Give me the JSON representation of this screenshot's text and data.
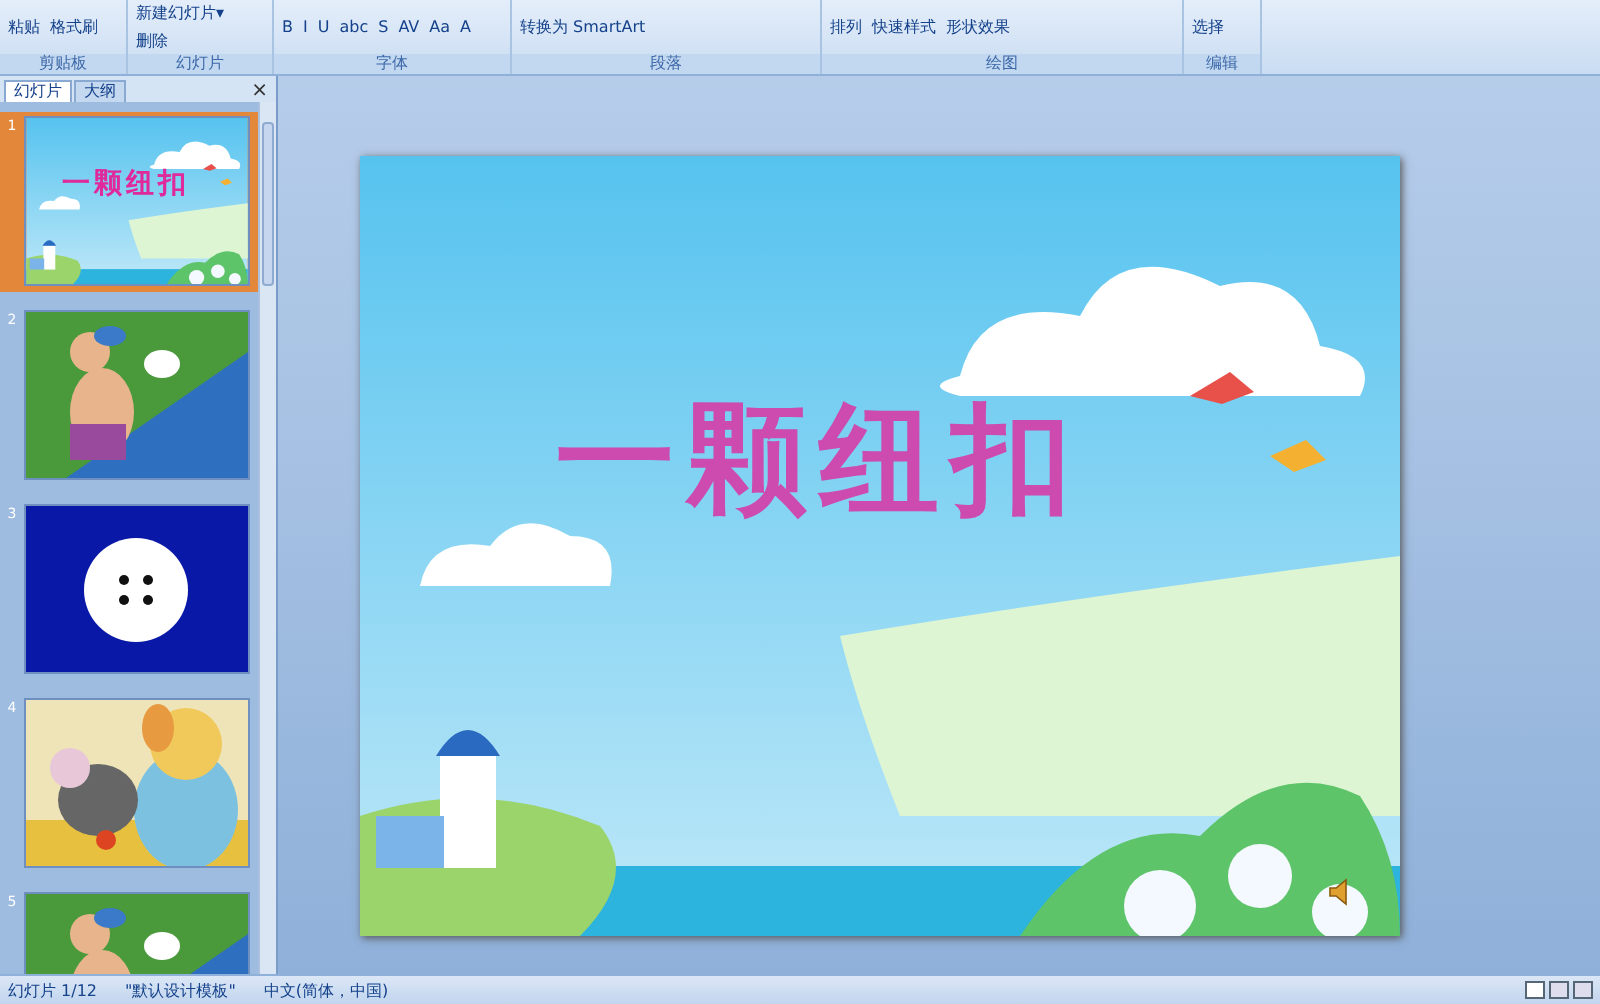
{
  "ribbon": {
    "groups": [
      {
        "label": "剪贴板",
        "buttons": [
          "粘贴",
          "格式刷"
        ]
      },
      {
        "label": "幻灯片",
        "buttons": [
          "新建幻灯片▾",
          "删除"
        ]
      },
      {
        "label": "字体",
        "buttons": [
          "B",
          "I",
          "U",
          "abc",
          "S",
          "AV",
          "Aa",
          "A"
        ]
      },
      {
        "label": "段落",
        "buttons": [
          "转换为 SmartArt"
        ]
      },
      {
        "label": "绘图",
        "buttons": [
          "排列",
          "快速样式",
          "形状效果"
        ]
      },
      {
        "label": "编辑",
        "buttons": [
          "选择"
        ]
      }
    ]
  },
  "panel": {
    "tabs": [
      {
        "label": "幻灯片",
        "selected": true
      },
      {
        "label": "大纲",
        "selected": false
      }
    ],
    "close": "×",
    "slides": [
      {
        "number": "1",
        "selected": true,
        "kind": "title",
        "title": "一颗纽扣"
      },
      {
        "number": "2",
        "selected": false,
        "kind": "picture"
      },
      {
        "number": "3",
        "selected": false,
        "kind": "button"
      },
      {
        "number": "4",
        "selected": false,
        "kind": "picture"
      },
      {
        "number": "5",
        "selected": false,
        "kind": "picture"
      }
    ]
  },
  "slide": {
    "title": "一颗纽扣"
  },
  "status_bar": [
    "幻灯片 1/12",
    "\"默认设计模板\"",
    "中文(简体，中国)"
  ]
}
